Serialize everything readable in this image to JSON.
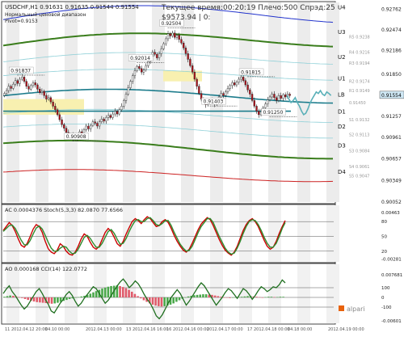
{
  "header": {
    "symbol_line": "USDCHF,H1  0.91631 0.91635 0.91544 0.91554",
    "comment_line1": "Нормальный ценовой диапазон",
    "comment_line2": "Pivot=0.9153",
    "status_line1": "Текущее время:00:20:19 Плечо:500 Спрэд:25",
    "status_line2": "$9573.94   |   0:"
  },
  "logo_text": "alpari",
  "chart_data": [
    {
      "type": "line",
      "title": "USDCHF,H1",
      "ylim": [
        0.9005,
        0.9285
      ],
      "y_ticks": [
        "0.92762",
        "0.92474",
        "0.92186",
        "0.91850",
        "0.91554",
        "0.91257",
        "0.90961",
        "0.90657",
        "0.90349",
        "0.90052"
      ],
      "x_ticks": [
        "11 2012.04.12 20:00",
        "04.10 00:00",
        "2012.04.13 00:00",
        "13 2012.04.16 16:00",
        "16 2012.04.16 00:00",
        "2012.04.17 00:00",
        "17 2012.04.18 00:00",
        "04.18 00:00",
        "2012.04.19 00:00"
      ],
      "last_price": "0.91554",
      "pivot_levels": [
        {
          "name": "U4",
          "value": 0.928
        },
        {
          "name": "U3",
          "value": 0.9245
        },
        {
          "name": "U2",
          "value": 0.921
        },
        {
          "name": "U1",
          "value": 0.918
        },
        {
          "name": "LB",
          "value": 0.9157
        },
        {
          "name": "D1",
          "value": 0.9133
        },
        {
          "name": "D2",
          "value": 0.9112
        },
        {
          "name": "D3",
          "value": 0.9085
        },
        {
          "name": "D4",
          "value": 0.9048
        }
      ],
      "right_labels": [
        {
          "name": "R5 0.9238",
          "value": 0.9238
        },
        {
          "name": "R4 0.9216",
          "value": 0.9216
        },
        {
          "name": "R3 0.9194",
          "value": 0.9201
        },
        {
          "name": "R2 0.9174",
          "value": 0.9175
        },
        {
          "name": "R1 0.9149",
          "value": 0.9162
        },
        {
          "name": "0.91450",
          "value": 0.9145
        },
        {
          "name": "S1 0.9132",
          "value": 0.9121
        },
        {
          "name": "S2 0.9113",
          "value": 0.91
        },
        {
          "name": "S3 0.9084",
          "value": 0.9077
        },
        {
          "name": "S4 0.9061",
          "value": 0.9055
        },
        {
          "name": "S5 0.9047",
          "value": 0.9042
        }
      ],
      "price_annotations": [
        {
          "label": "0.91837",
          "bar": 8,
          "value": 0.91837
        },
        {
          "label": "0.90908",
          "bar": 33,
          "value": 0.90908
        },
        {
          "label": "0.92014",
          "bar": 62,
          "value": 0.92014
        },
        {
          "label": "0.92504",
          "bar": 76,
          "value": 0.92504
        },
        {
          "label": "0.91403",
          "bar": 95,
          "value": 0.91403
        },
        {
          "label": "0.91815",
          "bar": 112,
          "value": 0.91815
        },
        {
          "label": "0.91250",
          "bar": 122,
          "value": 0.9125
        }
      ],
      "close": [
        0.9158,
        0.9162,
        0.9168,
        0.9165,
        0.9171,
        0.9176,
        0.9172,
        0.9178,
        0.9181,
        0.9175,
        0.9168,
        0.9164,
        0.9169,
        0.9173,
        0.917,
        0.9164,
        0.9159,
        0.9161,
        0.9155,
        0.915,
        0.9152,
        0.9146,
        0.914,
        0.9135,
        0.9128,
        0.9121,
        0.9114,
        0.9109,
        0.9103,
        0.9096,
        0.91,
        0.9095,
        0.9094,
        0.9098,
        0.9104,
        0.9101,
        0.9107,
        0.9112,
        0.9108,
        0.9113,
        0.9118,
        0.9116,
        0.9112,
        0.9118,
        0.9122,
        0.9119,
        0.9124,
        0.9127,
        0.9124,
        0.9129,
        0.9133,
        0.9129,
        0.9135,
        0.914,
        0.9148,
        0.9157,
        0.9166,
        0.9175,
        0.9183,
        0.919,
        0.9196,
        0.9193,
        0.9188,
        0.9191,
        0.9197,
        0.9203,
        0.921,
        0.9216,
        0.9213,
        0.9208,
        0.9214,
        0.9221,
        0.9228,
        0.9235,
        0.9242,
        0.9239,
        0.9243,
        0.9237,
        0.924,
        0.9234,
        0.9229,
        0.9222,
        0.9214,
        0.9206,
        0.9197,
        0.9188,
        0.9178,
        0.9168,
        0.9158,
        0.915,
        0.9146,
        0.9142,
        0.9145,
        0.9149,
        0.9146,
        0.9143,
        0.9148,
        0.9153,
        0.9158,
        0.9155,
        0.916,
        0.9165,
        0.9169,
        0.9173,
        0.917,
        0.9174,
        0.9178,
        0.9181,
        0.9176,
        0.917,
        0.9163,
        0.9157,
        0.9148,
        0.914,
        0.9133,
        0.9128,
        0.9132,
        0.9138,
        0.9143,
        0.9149,
        0.9153,
        0.9157,
        0.9152,
        0.9148,
        0.9155,
        0.9151,
        0.9156,
        0.9153,
        0.9157,
        0.9155
      ],
      "projection": [
        0.9155,
        0.915,
        0.9145,
        0.9148,
        0.9152,
        0.9145,
        0.914,
        0.9133,
        0.9128,
        0.913,
        0.9136,
        0.9144,
        0.915,
        0.9155,
        0.916,
        0.9158,
        0.9162,
        0.9157,
        0.9155,
        0.916,
        0.9158,
        0.9155
      ]
    },
    {
      "type": "line",
      "title": "AC 0.0004376  Stoch(5,3,3) 82.0870 77.6566",
      "y_ticks": [
        "0.00463",
        "80",
        "50",
        "20",
        "-0.00281"
      ],
      "levels": [
        80,
        50,
        20
      ],
      "series": [
        {
          "name": "Stoch main",
          "color": "#cc0000",
          "values": [
            62,
            70,
            78,
            72,
            60,
            45,
            32,
            28,
            36,
            50,
            65,
            74,
            70,
            58,
            40,
            25,
            18,
            15,
            22,
            35,
            30,
            20,
            14,
            12,
            18,
            30,
            45,
            55,
            50,
            38,
            28,
            24,
            30,
            44,
            58,
            66,
            60,
            48,
            35,
            30,
            40,
            55,
            68,
            80,
            86,
            82,
            76,
            84,
            90,
            86,
            78,
            70,
            72,
            80,
            84,
            78,
            66,
            52,
            40,
            30,
            22,
            18,
            24,
            36,
            50,
            64,
            75,
            82,
            88,
            84,
            72,
            58,
            44,
            32,
            22,
            16,
            12,
            18,
            30,
            46,
            62,
            74,
            82,
            86,
            80,
            70,
            56,
            42,
            30,
            24,
            28,
            40,
            56,
            70,
            82
          ]
        },
        {
          "name": "Stoch signal",
          "color": "#2e8b2e",
          "values": [
            60,
            66,
            72,
            73,
            66,
            54,
            42,
            33,
            33,
            42,
            55,
            67,
            71,
            65,
            52,
            38,
            26,
            20,
            20,
            26,
            30,
            28,
            20,
            15,
            16,
            24,
            36,
            48,
            52,
            46,
            36,
            28,
            28,
            36,
            48,
            60,
            64,
            56,
            44,
            34,
            36,
            46,
            60,
            72,
            82,
            84,
            80,
            80,
            86,
            88,
            82,
            74,
            72,
            76,
            82,
            82,
            72,
            58,
            46,
            34,
            26,
            20,
            22,
            30,
            44,
            58,
            70,
            78,
            86,
            86,
            78,
            64,
            50,
            38,
            26,
            18,
            14,
            16,
            26,
            40,
            56,
            70,
            80,
            84,
            82,
            74,
            62,
            48,
            36,
            28,
            28,
            36,
            50,
            66,
            78
          ]
        }
      ]
    },
    {
      "type": "bar",
      "title": "AO 0.000168  CCI(14) 122.0772",
      "y_ticks": [
        "0.007681",
        "100",
        "0",
        "-100",
        "-0.00601"
      ],
      "levels": [
        100,
        0,
        -100
      ],
      "cci": [
        40,
        85,
        120,
        60,
        20,
        -30,
        -80,
        -120,
        -90,
        -40,
        10,
        60,
        90,
        40,
        -20,
        -70,
        -140,
        -160,
        -110,
        -60,
        -20,
        30,
        60,
        20,
        -40,
        -90,
        -60,
        -10,
        30,
        70,
        110,
        90,
        40,
        -10,
        -60,
        -30,
        20,
        70,
        120,
        160,
        190,
        150,
        100,
        130,
        170,
        140,
        90,
        30,
        -20,
        -60,
        -120,
        -190,
        -220,
        -180,
        -120,
        -60,
        0,
        40,
        80,
        40,
        -20,
        -80,
        -40,
        10,
        60,
        110,
        150,
        120,
        70,
        20,
        -30,
        -80,
        -40,
        0,
        50,
        90,
        70,
        30,
        -10,
        40,
        90,
        70,
        30,
        -20,
        20,
        70,
        110,
        90,
        60,
        80,
        110,
        100,
        130,
        180,
        150
      ],
      "ao": [
        0.0002,
        0.0004,
        0.0006,
        0.0005,
        0.0003,
        0.0001,
        -0.0002,
        -0.0005,
        -0.0008,
        -0.0011,
        -0.0013,
        -0.0015,
        -0.0016,
        -0.0017,
        -0.0018,
        -0.0019,
        -0.002,
        -0.0019,
        -0.0017,
        -0.0014,
        -0.0011,
        -0.0008,
        -0.0005,
        -0.0003,
        -0.0001,
        0.0001,
        0.0003,
        0.0005,
        0.0008,
        0.0012,
        0.0016,
        0.002,
        0.0024,
        0.0028,
        0.0031,
        0.0034,
        0.0036,
        0.0037,
        0.0038,
        0.0036,
        0.0033,
        0.0029,
        0.0024,
        0.0018,
        0.0011,
        0.0004,
        -0.0003,
        -0.0009,
        -0.0014,
        -0.0019,
        -0.0023,
        -0.0026,
        -0.0028,
        -0.0029,
        -0.0028,
        -0.0026,
        -0.0023,
        -0.0019,
        -0.0014,
        -0.0009,
        -0.0004,
        0.0,
        0.0003,
        0.0005,
        0.0007,
        0.0008,
        0.0009,
        0.001,
        0.001,
        0.0009,
        0.0008,
        0.0006,
        0.0004,
        0.0002,
        0.0,
        -0.0001,
        -0.0002,
        -0.0001,
        0.0,
        0.0001,
        0.0002,
        0.0003,
        0.0004,
        0.0004,
        0.0003,
        0.0002,
        0.0001,
        0.0,
        0.0001,
        0.0002,
        0.0002,
        0.0001,
        0.0001,
        0.0002,
        0.0002
      ]
    }
  ]
}
